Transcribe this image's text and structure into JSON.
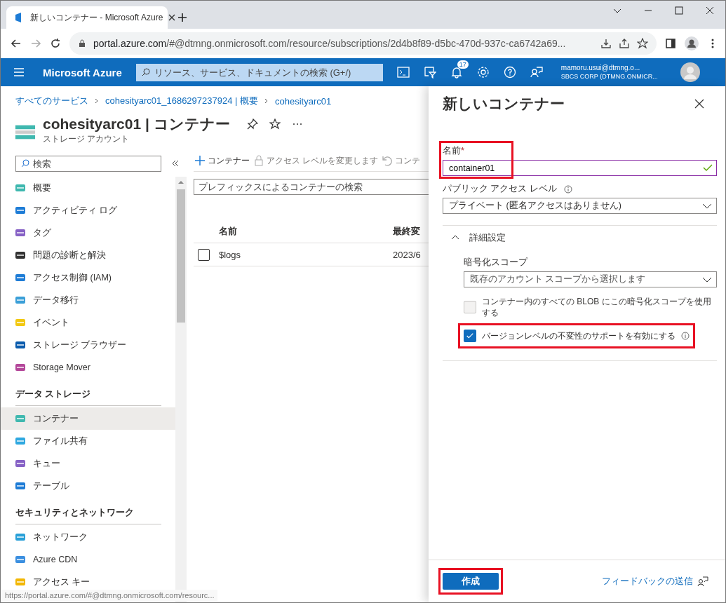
{
  "browser": {
    "tab_title": "新しいコンテナー - Microsoft Azure",
    "url_host": "portal.azure.com",
    "url_rest": "/#@dtmng.onmicrosoft.com/resource/subscriptions/2d4b8f89-d5bc-470d-937c-ca6742a69..."
  },
  "header": {
    "brand": "Microsoft Azure",
    "search_placeholder": "リソース、サービス、ドキュメントの検索 (G+/)",
    "notification_count": "17",
    "account_name": "mamoru.usui@dtmng.o...",
    "account_directory": "SBCS CORP (DTMNG.ONMICR..."
  },
  "breadcrumb": [
    "すべてのサービス",
    "cohesityarc01_1686297237924 | 概要",
    "cohesityarc01"
  ],
  "page": {
    "title": "cohesityarc01 | コンテナー",
    "subtitle": "ストレージ アカウント"
  },
  "sidebar": {
    "search_placeholder": "検索",
    "sections": [
      {
        "items": [
          {
            "label": "概要",
            "selected": false
          },
          {
            "label": "アクティビティ ログ",
            "selected": false
          },
          {
            "label": "タグ",
            "selected": false
          },
          {
            "label": "問題の診断と解決",
            "selected": false
          },
          {
            "label": "アクセス制御 (IAM)",
            "selected": false
          },
          {
            "label": "データ移行",
            "selected": false
          },
          {
            "label": "イベント",
            "selected": false
          },
          {
            "label": "ストレージ ブラウザー",
            "selected": false
          },
          {
            "label": "Storage Mover",
            "selected": false
          }
        ]
      },
      {
        "heading": "データ ストレージ",
        "items": [
          {
            "label": "コンテナー",
            "selected": true
          },
          {
            "label": "ファイル共有",
            "selected": false
          },
          {
            "label": "キュー",
            "selected": false
          },
          {
            "label": "テーブル",
            "selected": false
          }
        ]
      },
      {
        "heading": "セキュリティとネットワーク",
        "items": [
          {
            "label": "ネットワーク",
            "selected": false
          },
          {
            "label": "Azure CDN",
            "selected": false
          },
          {
            "label": "アクセス キー",
            "selected": false
          }
        ]
      }
    ]
  },
  "toolbar": [
    {
      "kind": "add",
      "label": "コンテナー",
      "disabled": false
    },
    {
      "kind": "lock",
      "label": "アクセス レベルを変更します",
      "disabled": true
    },
    {
      "kind": "undo",
      "label": "コンテ",
      "disabled": true
    }
  ],
  "container_search": {
    "placeholder": "プレフィックスによるコンテナーの検索"
  },
  "table": {
    "columns": [
      "名前",
      "最終変"
    ],
    "rows": [
      {
        "cells": [
          "$logs",
          "2023/6"
        ],
        "checked": false
      }
    ]
  },
  "status_url": "https://portal.azure.com/#@dtmng.onmicrosoft.com/resourc...",
  "panel": {
    "title": "新しいコンテナー",
    "name_field": {
      "label": "名前",
      "required": true,
      "required_mark": "*",
      "value": "container01",
      "valid": true,
      "highlighted": true
    },
    "access_level": {
      "label": "パブリック アクセス レベル",
      "value": "プライベート (匿名アクセスはありません)"
    },
    "advanced": {
      "label": "詳細設定",
      "expanded": true,
      "encryption_scope": {
        "label": "暗号化スコープ",
        "value": "既存のアカウント スコープから選択します"
      },
      "checkboxes": [
        {
          "label": "コンテナー内のすべての BLOB にこの暗号化スコープを使用する",
          "checked": false,
          "disabled": true,
          "info": false,
          "highlighted": false
        },
        {
          "label": "バージョンレベルの不変性のサポートを有効にする",
          "checked": true,
          "disabled": false,
          "info": true,
          "highlighted": true
        }
      ]
    },
    "create_button": {
      "label": "作成",
      "highlighted": true
    },
    "feedback_link": "フィードバックの送信"
  }
}
